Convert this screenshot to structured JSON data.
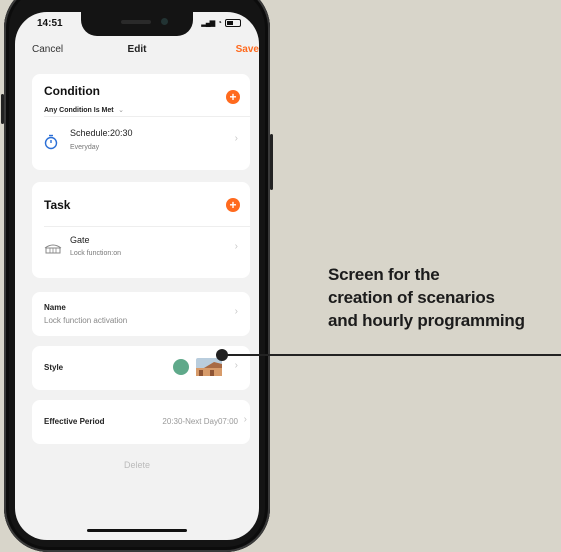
{
  "status_bar": {
    "time": "14:51"
  },
  "nav": {
    "cancel": "Cancel",
    "title": "Edit",
    "save": "Save"
  },
  "condition": {
    "title": "Condition",
    "mode": "Any Condition Is Met",
    "mode_caret": "⌄",
    "item": {
      "title": "Schedule:20:30",
      "subtitle": "Everyday",
      "icon": "timer-icon"
    }
  },
  "task": {
    "title": "Task",
    "item": {
      "title": "Gate",
      "subtitle": "Lock function:on",
      "icon": "gate-icon"
    }
  },
  "name": {
    "label": "Name",
    "value": "Lock function activation"
  },
  "style": {
    "label": "Style",
    "color": "#5fa98a"
  },
  "effective_period": {
    "label": "Effective Period",
    "value": "20:30-Next Day07:00"
  },
  "delete_label": "Delete",
  "chevron": "›",
  "plus": "+",
  "callout": {
    "lines": [
      "Screen for the",
      "creation of scenarios",
      "and hourly programming"
    ]
  },
  "colors": {
    "accent": "#ff6a1e",
    "background": "#d8d5ca"
  }
}
